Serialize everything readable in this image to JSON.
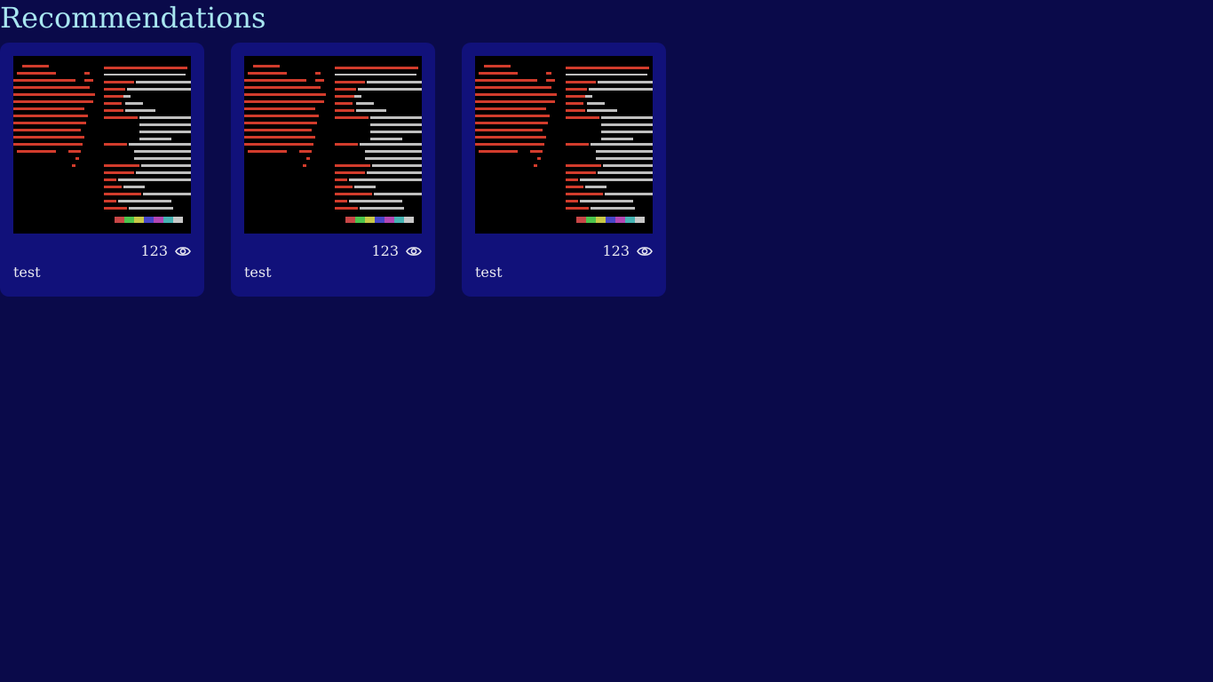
{
  "header": {
    "title": "Recommendations"
  },
  "cards": [
    {
      "title": "test",
      "views": "123",
      "icon": "eye-icon",
      "thumbnail": "terminal-screenshot"
    },
    {
      "title": "test",
      "views": "123",
      "icon": "eye-icon",
      "thumbnail": "terminal-screenshot"
    },
    {
      "title": "test",
      "views": "123",
      "icon": "eye-icon",
      "thumbnail": "terminal-screenshot"
    }
  ],
  "colors": {
    "background": "#0a0a4a",
    "card": "#11117a",
    "title": "#a8e6f0",
    "text": "#e8e8f0"
  }
}
